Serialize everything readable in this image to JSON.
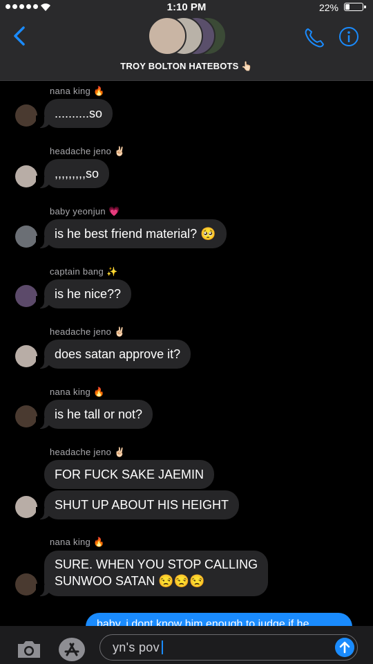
{
  "status": {
    "time": "1:10 PM",
    "battery_pct": "22%",
    "battery_level": 0.22
  },
  "header": {
    "group_name": "TROY BOLTON HATEBOTS 👆🏻",
    "back_icon": "chevron-left-icon",
    "call_icon": "phone-icon",
    "info_icon": "info-icon",
    "accent": "#1a8bfd"
  },
  "messages": [
    {
      "sender": "nana king",
      "emoji": "🔥",
      "text": "..........so"
    },
    {
      "sender": "headache jeno",
      "emoji": "✌🏻",
      "text": ",,,,,,,,,so"
    },
    {
      "sender": "baby yeonjun",
      "emoji": "💗",
      "text": "is he best friend material? 🥺"
    },
    {
      "sender": "captain bang",
      "emoji": "✨",
      "text": "is he nice??"
    },
    {
      "sender": "headache jeno",
      "emoji": "✌🏻",
      "text": "does satan approve it?"
    },
    {
      "sender": "nana king",
      "emoji": "🔥",
      "text": "is he tall or not?"
    },
    {
      "sender": "headache jeno",
      "emoji": "✌🏻",
      "text": "FOR FUCK SAKE JAEMIN",
      "text2": "SHUT UP ABOUT HIS HEIGHT"
    },
    {
      "sender": "nana king",
      "emoji": "🔥",
      "text_line1": "SURE. WHEN YOU STOP CALLING",
      "text_line2": "SUNWOO SATAN 😒😒😒"
    }
  ],
  "outgoing": {
    "text": "baby, i dont know him enough to judge if he"
  },
  "input": {
    "value": "yn's pov",
    "camera_icon": "camera-icon",
    "apps_icon": "app-store-icon",
    "send_icon": "send-arrow-icon"
  }
}
